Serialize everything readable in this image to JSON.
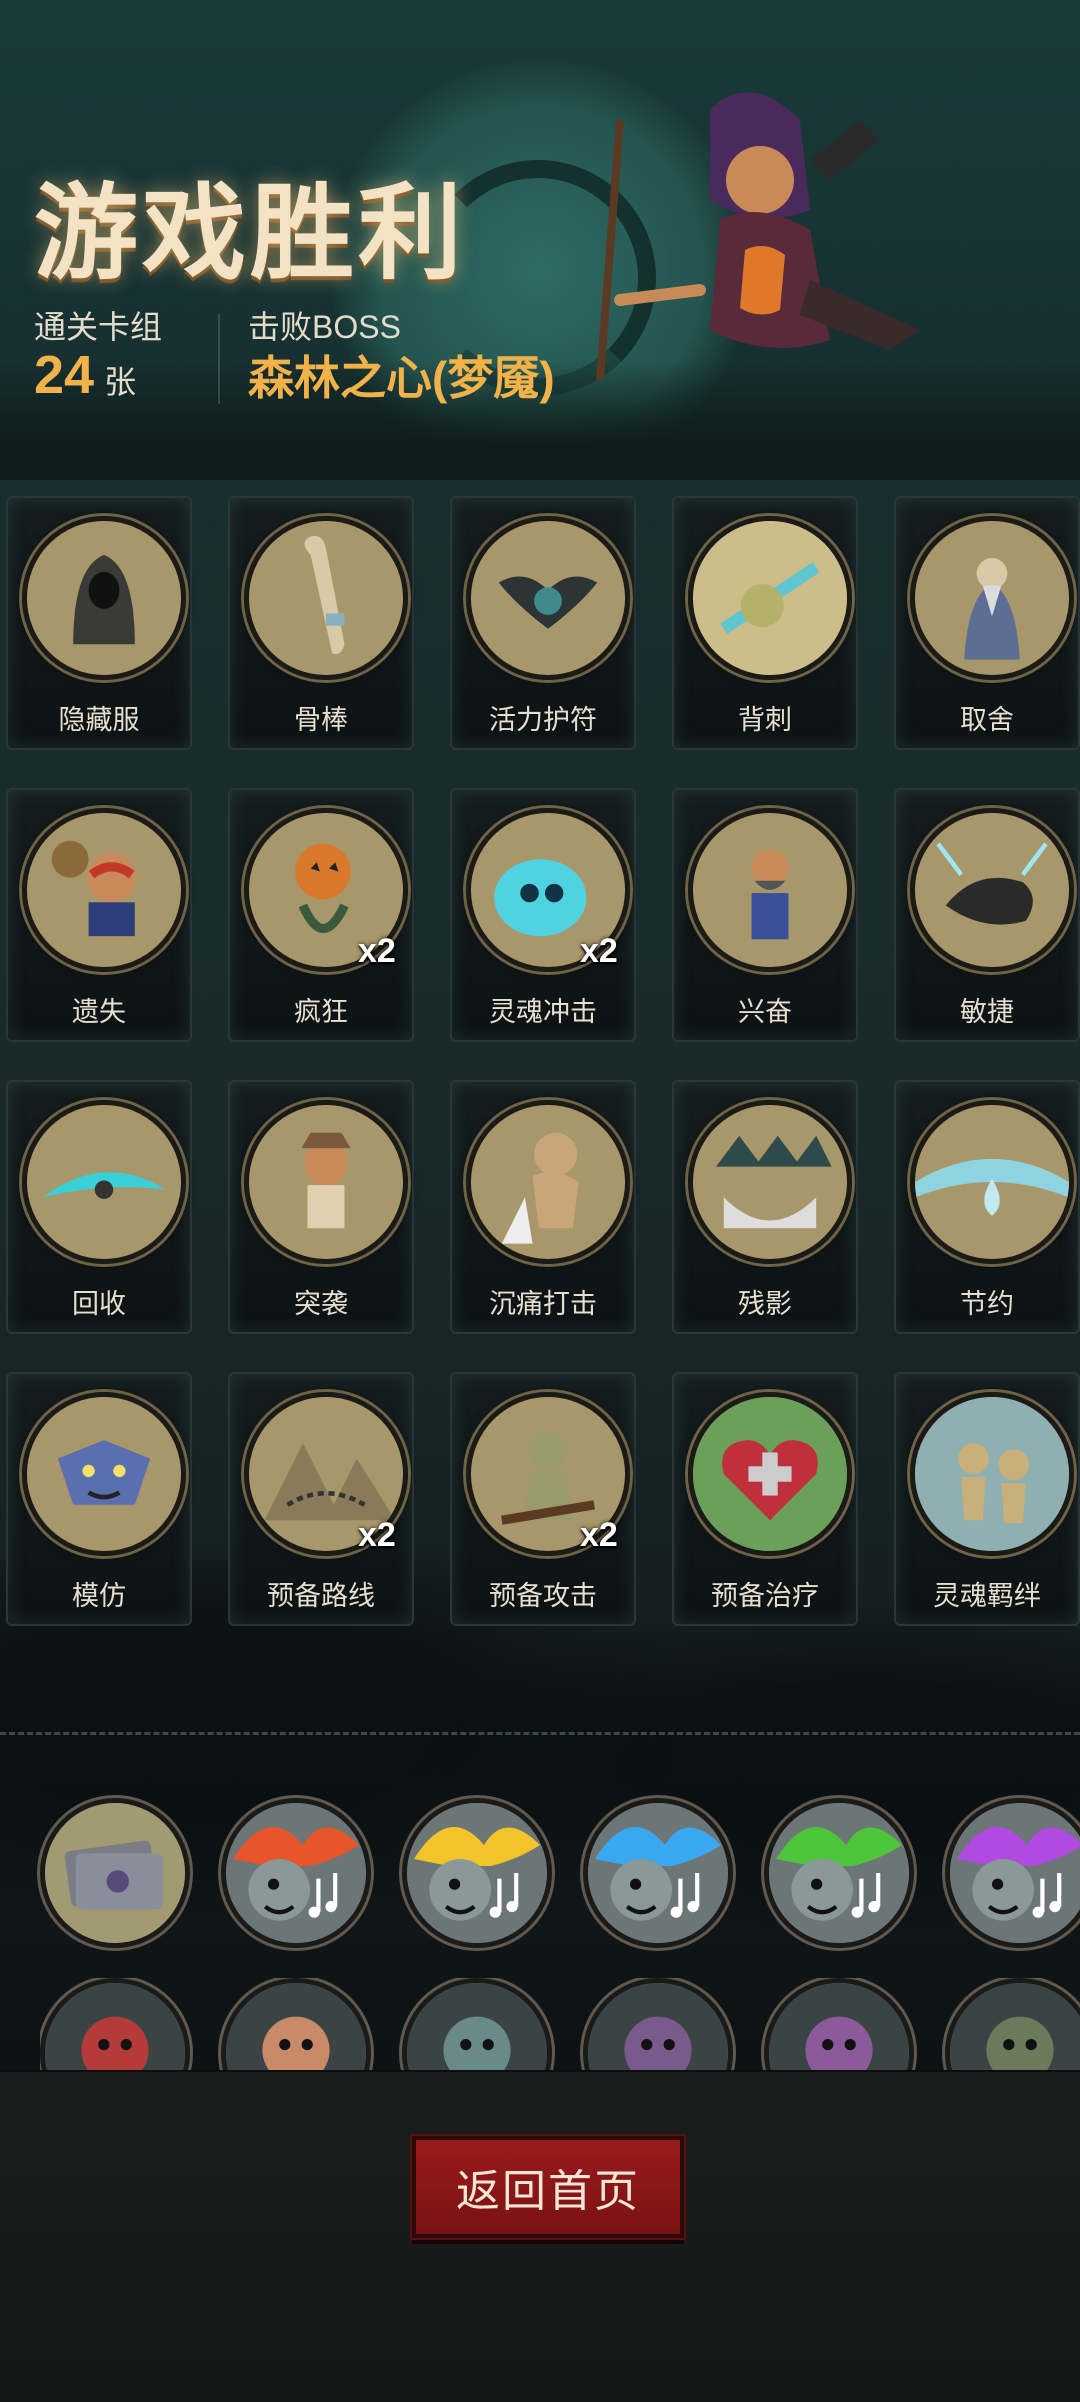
{
  "header": {
    "title": "游戏胜利",
    "deck_label": "通关卡组",
    "deck_count": "24",
    "deck_unit": "张",
    "boss_label": "击败BOSS",
    "boss_name": "森林之心(梦魇)"
  },
  "cards": [
    {
      "name": "隐藏服",
      "multiplier": "",
      "icon": "hooded-cloak-icon",
      "color": "#3a3a36"
    },
    {
      "name": "骨棒",
      "multiplier": "",
      "icon": "bone-club-icon",
      "color": "#d9c9a6"
    },
    {
      "name": "活力护符",
      "multiplier": "",
      "icon": "bat-amulet-icon",
      "color": "#2c3436"
    },
    {
      "name": "背刺",
      "multiplier": "",
      "icon": "backstab-icon",
      "color": "#5fc6d0"
    },
    {
      "name": "取舍",
      "multiplier": "",
      "icon": "robed-sage-icon",
      "color": "#5c6f93"
    },
    {
      "name": "遗失",
      "multiplier": "",
      "icon": "thief-icon",
      "color": "#c0392b"
    },
    {
      "name": "疯狂",
      "multiplier": "x2",
      "icon": "pumpkin-head-icon",
      "color": "#d9782a"
    },
    {
      "name": "灵魂冲击",
      "multiplier": "x2",
      "icon": "soul-skull-icon",
      "color": "#4fd3e0"
    },
    {
      "name": "兴奋",
      "multiplier": "",
      "icon": "dwarf-warrior-icon",
      "color": "#3a4f9a"
    },
    {
      "name": "敏捷",
      "multiplier": "",
      "icon": "panther-icon",
      "color": "#2a2a2a"
    },
    {
      "name": "回收",
      "multiplier": "",
      "icon": "spinning-blade-icon",
      "color": "#3ad0d8"
    },
    {
      "name": "突袭",
      "multiplier": "",
      "icon": "raider-icon",
      "color": "#7a5a3a"
    },
    {
      "name": "沉痛打击",
      "multiplier": "",
      "icon": "ogre-smash-icon",
      "color": "#c9a57a"
    },
    {
      "name": "残影",
      "multiplier": "",
      "icon": "shadow-clones-icon",
      "color": "#2f4a4a"
    },
    {
      "name": "节约",
      "multiplier": "",
      "icon": "water-drop-icon",
      "color": "#8fd3e0"
    },
    {
      "name": "模仿",
      "multiplier": "",
      "icon": "goblin-mask-icon",
      "color": "#5a6fb0"
    },
    {
      "name": "预备路线",
      "multiplier": "x2",
      "icon": "mountain-map-icon",
      "color": "#8a7a5a"
    },
    {
      "name": "预备攻击",
      "multiplier": "x2",
      "icon": "goblin-fighter-icon",
      "color": "#9a9a6a"
    },
    {
      "name": "预备治疗",
      "multiplier": "",
      "icon": "heart-cross-icon",
      "color": "#c0303a"
    },
    {
      "name": "灵魂羁绊",
      "multiplier": "",
      "icon": "soul-bond-icon",
      "color": "#8fb0b0"
    }
  ],
  "relics_row1": [
    {
      "icon": "card-pack-icon",
      "color": "#7a7d86"
    },
    {
      "icon": "bard-red-flame-icon",
      "color": "#e8552a"
    },
    {
      "icon": "bard-yellow-flame-icon",
      "color": "#f2c42a"
    },
    {
      "icon": "bard-blue-flame-icon",
      "color": "#3aa8f0"
    },
    {
      "icon": "bard-green-flame-icon",
      "color": "#4ec43a"
    },
    {
      "icon": "bard-purple-flame-icon",
      "color": "#b04ae0"
    }
  ],
  "relics_row2": [
    {
      "icon": "goblin-portrait-icon",
      "color": "#b53a3a"
    },
    {
      "icon": "brute-portrait-icon",
      "color": "#c98a6a"
    },
    {
      "icon": "scavenger-portrait-icon",
      "color": "#6a8a8a"
    },
    {
      "icon": "gargoyle-portrait-icon",
      "color": "#7a5a8a"
    },
    {
      "icon": "vampire-portrait-icon",
      "color": "#8a5a9a"
    },
    {
      "icon": "swordsman-portrait-icon",
      "color": "#6a7a5a"
    }
  ],
  "buttons": {
    "home": "返回首页"
  }
}
